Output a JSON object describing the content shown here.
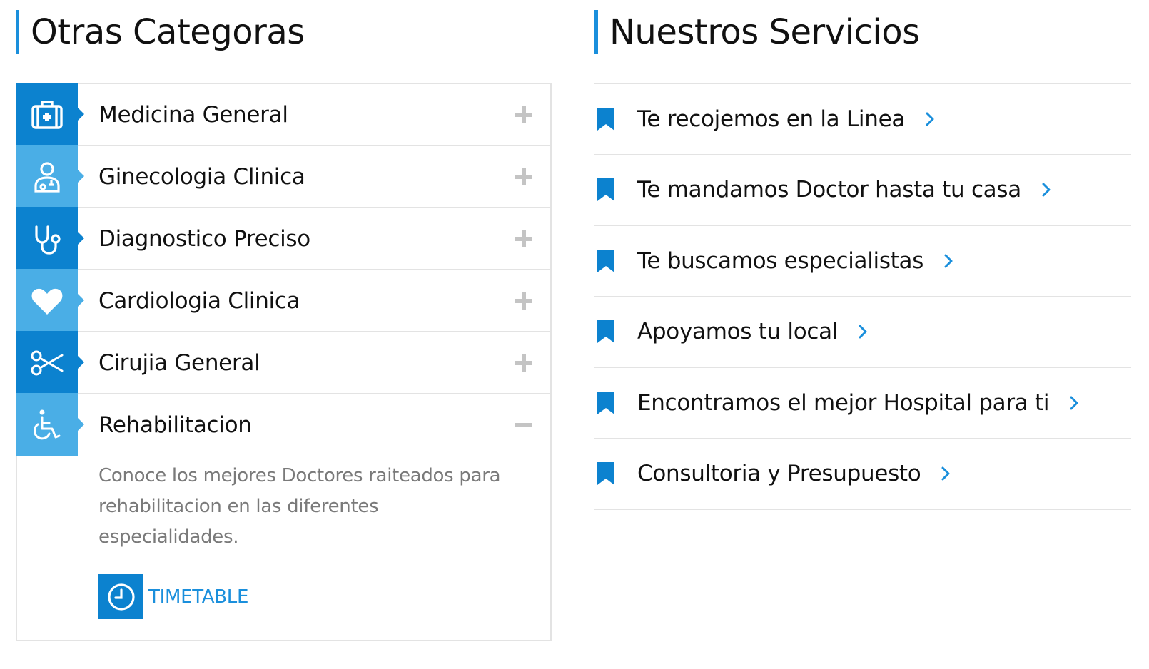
{
  "left_section": {
    "title": "Otras Categoras"
  },
  "right_section": {
    "title": "Nuestros Servicios"
  },
  "categories": [
    {
      "label": "Medicina General",
      "icon": "medkit-icon",
      "expanded": false
    },
    {
      "label": "Ginecologia Clinica",
      "icon": "doctor-icon",
      "expanded": false
    },
    {
      "label": "Diagnostico Preciso",
      "icon": "stethoscope-icon",
      "expanded": false
    },
    {
      "label": "Cardiologia Clinica",
      "icon": "heart-icon",
      "expanded": false
    },
    {
      "label": "Cirujia General",
      "icon": "scissors-icon",
      "expanded": false
    },
    {
      "label": "Rehabilitacion",
      "icon": "wheelchair-icon",
      "expanded": true
    }
  ],
  "expanded_panel": {
    "description": "Conoce los mejores Doctores raiteados para rehabilitacion en las diferentes especialidades.",
    "action_label": "TIMETABLE",
    "action_icon": "clock-icon"
  },
  "services": [
    {
      "label": "Te recojemos en la Linea"
    },
    {
      "label": "Te mandamos Doctor hasta tu casa"
    },
    {
      "label": "Te buscamos especialistas"
    },
    {
      "label": "Apoyamos tu local"
    },
    {
      "label": "Encontramos el mejor Hospital para ti"
    },
    {
      "label": "Consultoria y Presupuesto"
    }
  ],
  "colors": {
    "accent": "#1a8fdc",
    "icon_dark": "#0c82cf",
    "icon_light": "#4aaee6",
    "border": "#e3e3e3",
    "toggle": "#c4c4c4",
    "muted_text": "#7a7a7a"
  }
}
